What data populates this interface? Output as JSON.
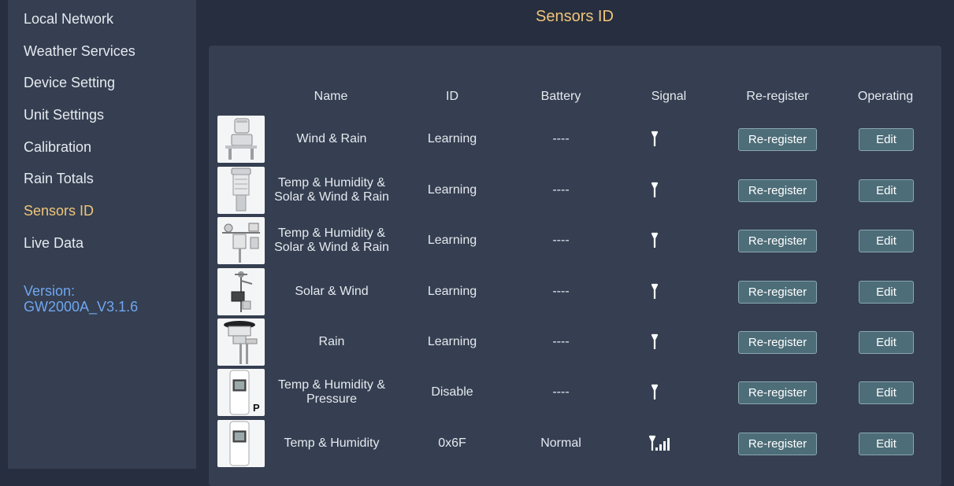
{
  "sidebar": {
    "items": [
      {
        "label": "Local Network"
      },
      {
        "label": "Weather Services"
      },
      {
        "label": "Device Setting"
      },
      {
        "label": "Unit Settings"
      },
      {
        "label": "Calibration"
      },
      {
        "label": "Rain Totals"
      },
      {
        "label": "Sensors ID",
        "active": true
      },
      {
        "label": "Live Data"
      }
    ],
    "version_label": "Version:",
    "version_value": "GW2000A_V3.1.6"
  },
  "page_title": "Sensors ID",
  "table": {
    "headers": [
      "Name",
      "ID",
      "Battery",
      "Signal",
      "Re-register",
      "Operating"
    ],
    "rows": [
      {
        "name_line1": "Wind & Rain",
        "name_line2": "",
        "id": "Learning",
        "battery": "----",
        "signal": "none",
        "reregister": "Re-register",
        "edit": "Edit",
        "icon": "wind-rain-sensor-icon"
      },
      {
        "name_line1": "Temp & Humidity &",
        "name_line2": "Solar & Wind & Rain",
        "id": "Learning",
        "battery": "----",
        "signal": "none",
        "reregister": "Re-register",
        "edit": "Edit",
        "icon": "ultrasonic-sensor-icon"
      },
      {
        "name_line1": "Temp & Humidity &",
        "name_line2": "Solar & Wind & Rain",
        "id": "Learning",
        "battery": "----",
        "signal": "none",
        "reregister": "Re-register",
        "edit": "Edit",
        "icon": "weather-array-icon"
      },
      {
        "name_line1": "Solar & Wind",
        "name_line2": "",
        "id": "Learning",
        "battery": "----",
        "signal": "none",
        "reregister": "Re-register",
        "edit": "Edit",
        "icon": "solar-wind-sensor-icon"
      },
      {
        "name_line1": "Rain",
        "name_line2": "",
        "id": "Learning",
        "battery": "----",
        "signal": "none",
        "reregister": "Re-register",
        "edit": "Edit",
        "icon": "rain-gauge-icon"
      },
      {
        "name_line1": "Temp & Humidity &",
        "name_line2": "Pressure",
        "id": "Disable",
        "battery": "----",
        "signal": "none",
        "reregister": "Re-register",
        "edit": "Edit",
        "icon": "thp-sensor-icon",
        "badge": "P"
      },
      {
        "name_line1": "Temp & Humidity",
        "name_line2": "",
        "id": "0x6F",
        "battery": "Normal",
        "signal": "full",
        "reregister": "Re-register",
        "edit": "Edit",
        "icon": "th-sensor-icon"
      }
    ]
  },
  "colors": {
    "background": "#262e3f",
    "panel": "#353f51",
    "accent": "#f1c57a",
    "version": "#6fa6f0",
    "button": "#4d6d78"
  }
}
